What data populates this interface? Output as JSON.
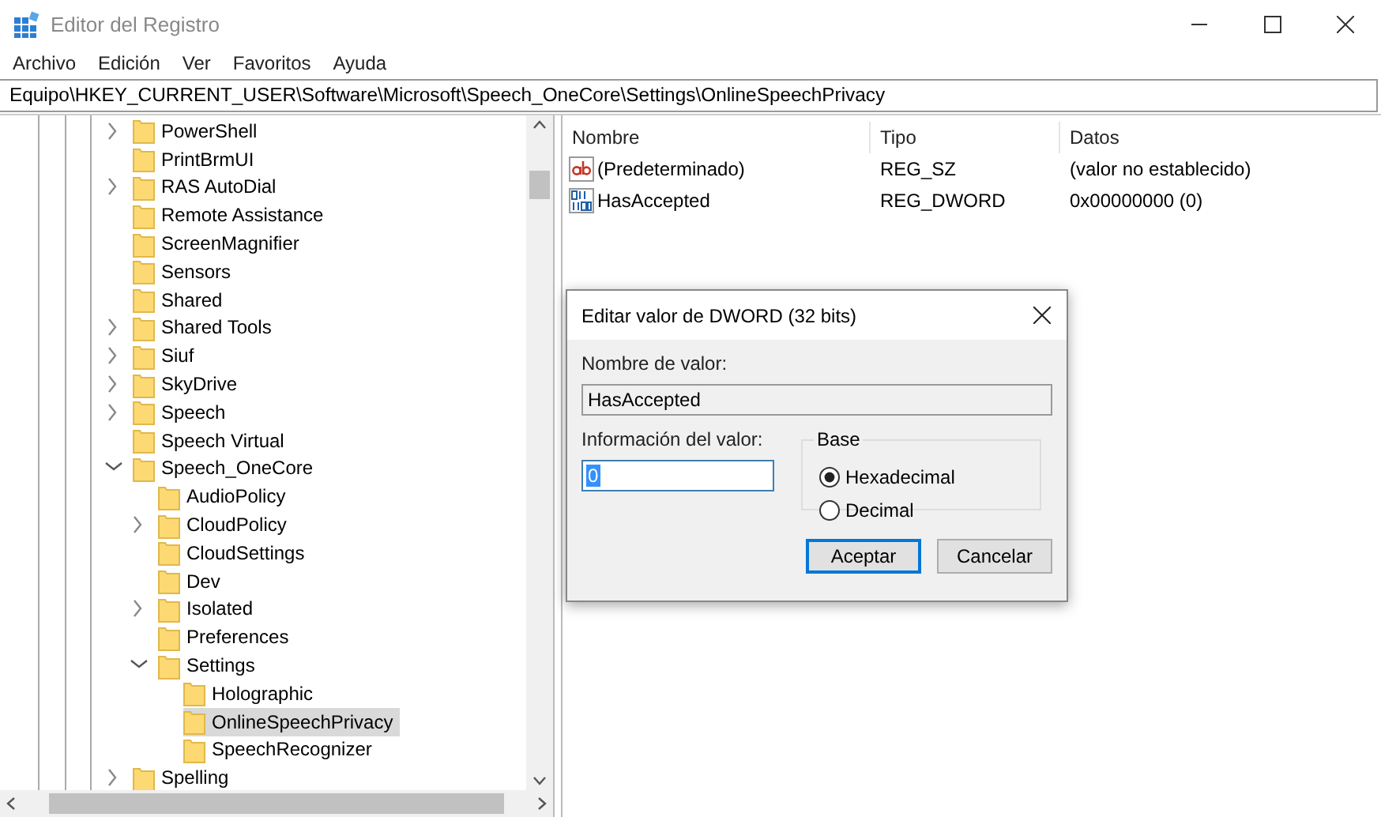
{
  "window": {
    "title": "Editor del Registro"
  },
  "menu": [
    "Archivo",
    "Edición",
    "Ver",
    "Favoritos",
    "Ayuda"
  ],
  "address": "Equipo\\HKEY_CURRENT_USER\\Software\\Microsoft\\Speech_OneCore\\Settings\\OnlineSpeechPrivacy",
  "tree": [
    {
      "label": "PowerShell",
      "expanded": false,
      "selected": false
    },
    {
      "label": "PrintBrmUI",
      "selected": false
    },
    {
      "label": "RAS AutoDial",
      "expanded": false,
      "selected": false
    },
    {
      "label": "Remote Assistance",
      "selected": false
    },
    {
      "label": "ScreenMagnifier",
      "selected": false
    },
    {
      "label": "Sensors",
      "selected": false
    },
    {
      "label": "Shared",
      "selected": false
    },
    {
      "label": "Shared Tools",
      "expanded": false,
      "selected": false
    },
    {
      "label": "Siuf",
      "expanded": false,
      "selected": false
    },
    {
      "label": "SkyDrive",
      "expanded": false,
      "selected": false
    },
    {
      "label": "Speech",
      "expanded": false,
      "selected": false
    },
    {
      "label": "Speech Virtual",
      "selected": false
    },
    {
      "label": "Speech_OneCore",
      "expanded": true,
      "selected": false,
      "children": [
        {
          "label": "AudioPolicy",
          "selected": false
        },
        {
          "label": "CloudPolicy",
          "expanded": false,
          "selected": false
        },
        {
          "label": "CloudSettings",
          "selected": false
        },
        {
          "label": "Dev",
          "selected": false
        },
        {
          "label": "Isolated",
          "expanded": false,
          "selected": false
        },
        {
          "label": "Preferences",
          "selected": false
        },
        {
          "label": "Settings",
          "expanded": true,
          "selected": false,
          "children": [
            {
              "label": "Holographic",
              "selected": false
            },
            {
              "label": "OnlineSpeechPrivacy",
              "selected": true
            },
            {
              "label": "SpeechRecognizer",
              "selected": false
            }
          ]
        }
      ]
    },
    {
      "label": "Spelling",
      "expanded": false,
      "selected": false
    }
  ],
  "values": {
    "columns": [
      "Nombre",
      "Tipo",
      "Datos"
    ],
    "rows": [
      {
        "kind": "string",
        "name": "(Predeterminado)",
        "type": "REG_SZ",
        "data": "(valor no establecido)"
      },
      {
        "kind": "binary",
        "name": "HasAccepted",
        "type": "REG_DWORD",
        "data": "0x00000000 (0)"
      }
    ]
  },
  "dialog": {
    "title": "Editar valor de DWORD (32 bits)",
    "name_label": "Nombre de valor:",
    "name_value": "HasAccepted",
    "data_label": "Información del valor:",
    "data_value": "0",
    "base_label": "Base",
    "radios": [
      {
        "label": "Hexadecimal",
        "selected": true
      },
      {
        "label": "Decimal",
        "selected": false
      }
    ],
    "buttons": [
      {
        "label": "Aceptar",
        "default": true
      },
      {
        "label": "Cancelar",
        "default": false
      }
    ]
  }
}
